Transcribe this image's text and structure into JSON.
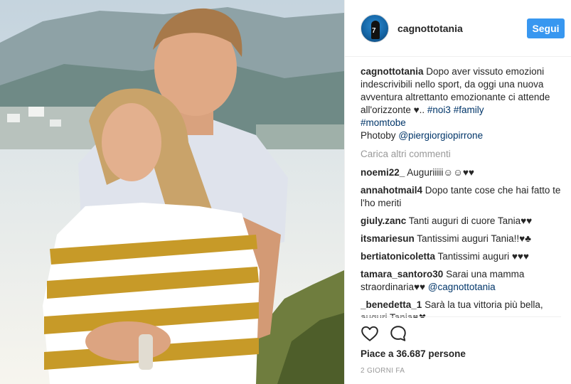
{
  "post": {
    "username": "cagnottotania",
    "follow_label": "Segui",
    "avatar_text": "7",
    "caption": {
      "username": "cagnottotania",
      "text": "Dopo aver vissuto emozioni indescrivibili nello sport, da oggi una nuova avventura altrettanto emozionante ci attende all'orizzonte ♥..",
      "hashtags": [
        "#noi3",
        "#family",
        "#momtobe"
      ],
      "photo_prefix": "Photoby",
      "photo_mention": "@piergiorgiopirrone"
    },
    "load_more": "Carica altri commenti",
    "comments": [
      {
        "user": "noemi22_",
        "text": "Auguriiiii☺☺♥♥"
      },
      {
        "user": "annahotmail4",
        "text": "Dopo tante cose che hai fatto te l'ho meriti"
      },
      {
        "user": "giuly.zanc",
        "text": "Tanti auguri di cuore Tania♥♥"
      },
      {
        "user": "itsmariesun",
        "text": "Tantissimi auguri Tania!!♥♣"
      },
      {
        "user": "bertiatonicoletta",
        "text": "Tantissimi auguri ♥♥♥"
      },
      {
        "user": "tamara_santoro30",
        "text": "Sarai una mamma straordinaria♥♥",
        "mention": "@cagnottotania"
      },
      {
        "user": "_benedetta_1",
        "text": "Sarà la tua vittoria più bella, auguri Tania♥✖"
      }
    ],
    "likes": "Piace a 36.687 persone",
    "timestamp": "2 GIORNI FA",
    "icons": {
      "like": "heart-icon",
      "comment": "speech-bubble-icon"
    }
  },
  "colors": {
    "follow_button": "#3897f0",
    "link": "#003569",
    "muted": "#999999",
    "text": "#262626"
  }
}
